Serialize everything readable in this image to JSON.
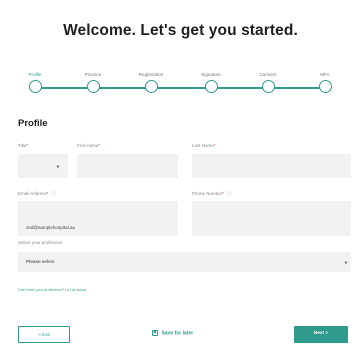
{
  "page_title": "Welcome. Let's get you started.",
  "steps": [
    {
      "label": "Profile",
      "active": true
    },
    {
      "label": "Practice",
      "active": false
    },
    {
      "label": "Registration",
      "active": false
    },
    {
      "label": "Signature",
      "active": false
    },
    {
      "label": "Connect",
      "active": false
    },
    {
      "label": "MFA",
      "active": false
    }
  ],
  "section_title": "Profile",
  "form": {
    "title_label": "Title",
    "first_name_label": "First name",
    "last_name_label": "Last Name",
    "email_label": "Email Address",
    "email_value": "zed@samplehospital.au",
    "phone_label": "Phone Number",
    "profession_label": "Select your profession",
    "profession_value": "Please select",
    "profession_help": "Can't find your profession? Let us know.",
    "required_mark": "*"
  },
  "footer": {
    "exit_label": "< Exit",
    "save_label": "Save for later",
    "next_label": "Next >"
  },
  "colors": {
    "accent": "#2f9b8c",
    "field_bg": "#f1f2f3",
    "required": "#d33333"
  },
  "icons": {
    "info": "info-icon",
    "save": "save-icon",
    "dropdown": "chevron-down-icon"
  }
}
